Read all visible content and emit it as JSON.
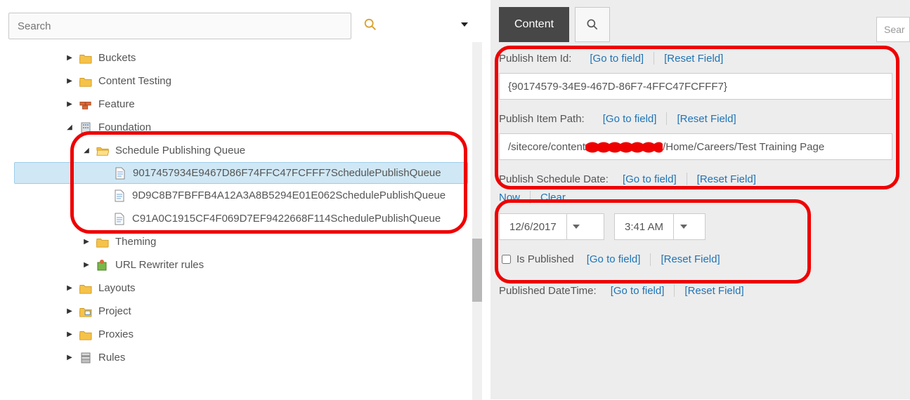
{
  "left": {
    "search_placeholder": "Search",
    "tree": {
      "buckets": "Buckets",
      "content_testing": "Content Testing",
      "feature": "Feature",
      "foundation": "Foundation",
      "spq": "Schedule Publishing Queue",
      "item1": "9017457934E9467D86F74FFC47FCFFF7SchedulePublishQueue",
      "item2": "9D9C8B7FBFFB4A12A3A8B5294E01E062SchedulePublishQueue",
      "item3": "C91A0C1915CF4F069D7EF9422668F114SchedulePublishQueue",
      "theming": "Theming",
      "url_rewriter": "URL Rewriter rules",
      "layouts": "Layouts",
      "project": "Project",
      "proxies": "Proxies",
      "rules": "Rules"
    }
  },
  "right": {
    "tab_content": "Content",
    "search_placeholder_cut": "Sear",
    "links": {
      "goto": "[Go to field]",
      "reset": "[Reset Field]",
      "now": "Now",
      "clear": "Clear"
    },
    "publish_item_id": {
      "label": "Publish Item Id:",
      "value": "{90174579-34E9-467D-86F7-4FFC47FCFFF7}"
    },
    "publish_item_path": {
      "label": "Publish Item Path:",
      "value_pre": "/sitecore/content",
      "value_post": "/Home/Careers/Test Training Page"
    },
    "publish_schedule_date": {
      "label": "Publish Schedule Date:",
      "date": "12/6/2017",
      "time": "3:41 AM"
    },
    "is_published": {
      "label": "Is Published"
    },
    "published_datetime": {
      "label": "Published DateTime:"
    }
  }
}
